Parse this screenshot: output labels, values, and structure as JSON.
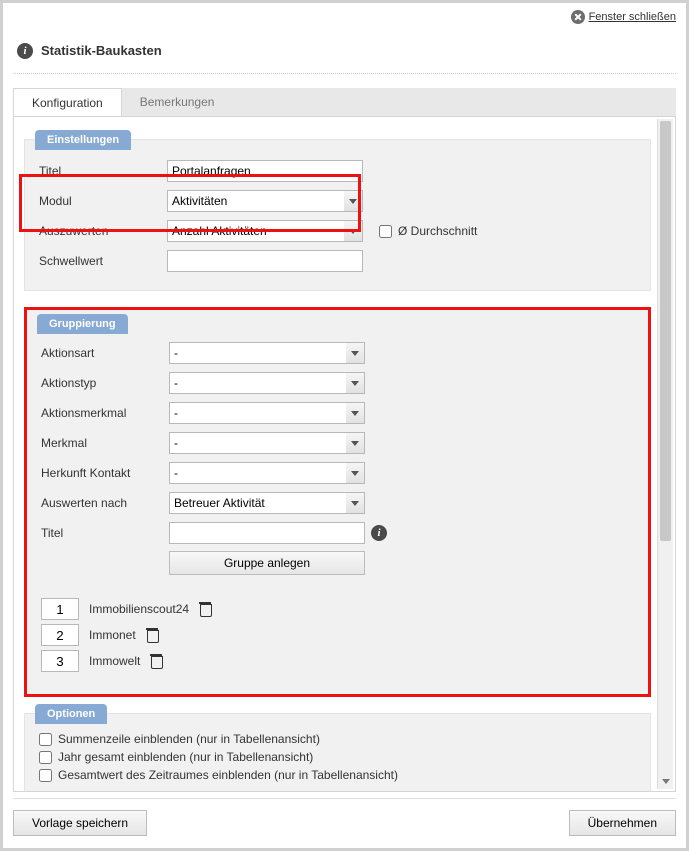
{
  "window": {
    "close_label": "Fenster schließen",
    "title": "Statistik-Baukasten"
  },
  "tabs": {
    "konfiguration": "Konfiguration",
    "bemerkungen": "Bemerkungen"
  },
  "sections": {
    "einstellungen": "Einstellungen",
    "gruppierung": "Gruppierung",
    "optionen": "Optionen"
  },
  "einstellungen": {
    "titel_label": "Titel",
    "titel_value": "Portalanfragen",
    "modul_label": "Modul",
    "modul_value": "Aktivitäten",
    "auszuwerten_label": "Auszuwerten",
    "auszuwerten_value": "Anzahl Aktivitäten",
    "durchschnitt_label": "Ø Durchschnitt",
    "schwellwert_label": "Schwellwert",
    "schwellwert_value": ""
  },
  "gruppierung": {
    "aktionsart_label": "Aktionsart",
    "aktionsart_value": "-",
    "aktionstyp_label": "Aktionstyp",
    "aktionstyp_value": "-",
    "aktionsmerkmal_label": "Aktionsmerkmal",
    "aktionsmerkmal_value": "-",
    "merkmal_label": "Merkmal",
    "merkmal_value": "-",
    "herkunft_label": "Herkunft Kontakt",
    "herkunft_value": "-",
    "auswerten_label": "Auswerten nach",
    "auswerten_value": "Betreuer Aktivität",
    "titel_label": "Titel",
    "titel_value": "",
    "create_button": "Gruppe anlegen",
    "items": [
      {
        "order": "1",
        "name": "Immobilienscout24"
      },
      {
        "order": "2",
        "name": "Immonet"
      },
      {
        "order": "3",
        "name": "Immowelt"
      }
    ]
  },
  "optionen": {
    "summenzeile": "Summenzeile einblenden (nur in Tabellenansicht)",
    "jahr": "Jahr gesamt einblenden (nur in Tabellenansicht)",
    "gesamtwert": "Gesamtwert des Zeitraumes einblenden (nur in Tabellenansicht)"
  },
  "footer": {
    "save_template": "Vorlage speichern",
    "apply": "Übernehmen"
  }
}
